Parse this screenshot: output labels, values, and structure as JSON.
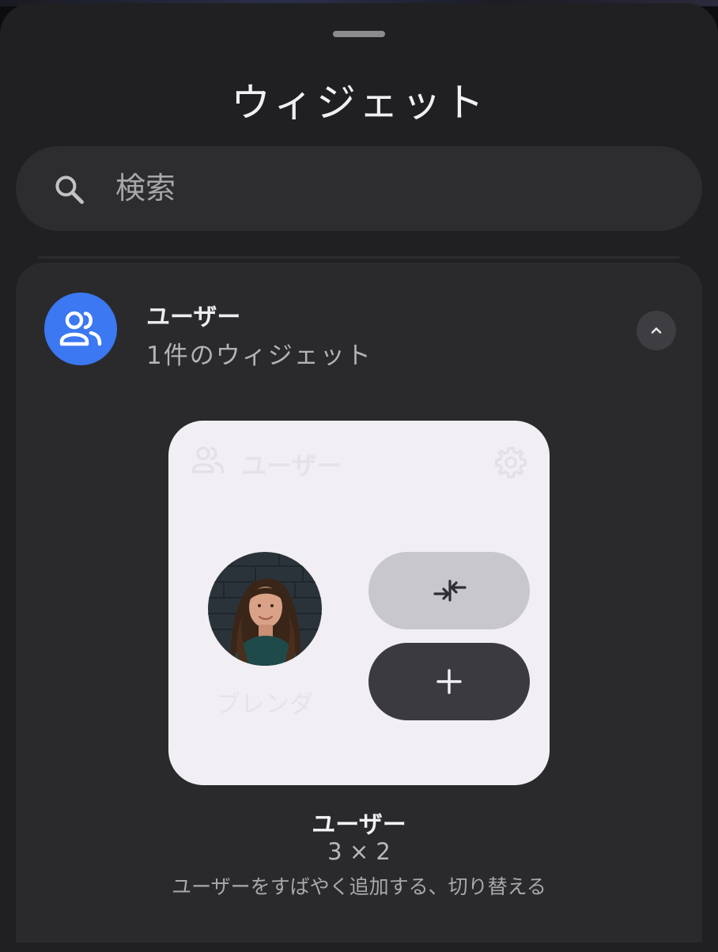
{
  "sheet": {
    "title": "ウィジェット"
  },
  "search": {
    "placeholder": "検索",
    "icon": "search-icon"
  },
  "app_group": {
    "name": "ユーザー",
    "widget_count": "1件のウィジェット",
    "icon": "people-icon",
    "icon_bg_color": "#3b78f2",
    "collapse_icon": "chevron-up-icon"
  },
  "widget_preview": {
    "header_label": "ユーザー",
    "header_icon": "people-outline-icon",
    "settings_icon": "gear-icon",
    "user_name": "ブレンダ",
    "switch_icon": "collapse-arrows-icon",
    "add_icon": "plus-icon"
  },
  "widget_info": {
    "name": "ユーザー",
    "size": "3 × 2",
    "description": "ユーザーをすばやく追加する、切り替える"
  },
  "colors": {
    "sheet_bg": "#202023",
    "card_bg": "#2a2a2d",
    "preview_bg": "#f1eff4"
  }
}
